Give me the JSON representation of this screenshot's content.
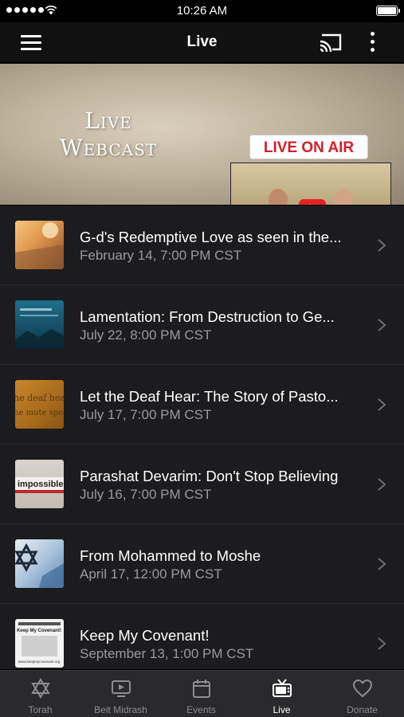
{
  "status_bar": {
    "time": "10:26 AM"
  },
  "nav": {
    "title": "Live"
  },
  "banner": {
    "title_line1": "Live",
    "title_line2": "Webcast",
    "badge": "LIVE ON AIR"
  },
  "events": [
    {
      "title": "G-d's Redemptive Love as seen in the...",
      "date": "February 14, 7:00 PM CST"
    },
    {
      "title": "Lamentation: From Destruction to Ge...",
      "date": "July 22, 8:00 PM CST"
    },
    {
      "title": "Let the Deaf Hear: The Story of Pasto...",
      "date": "July 17, 7:00 PM CST"
    },
    {
      "title": "Parashat Devarim: Don't Stop Believing",
      "date": "July 16, 7:00 PM CST"
    },
    {
      "title": "From Mohammed to Moshe",
      "date": "April 17, 12:00 PM CST"
    },
    {
      "title": "Keep My Covenant!",
      "date": "September 13, 1:00 PM CST"
    }
  ],
  "thumbnail_text": {
    "deaf_line1": "he deaf hea",
    "deaf_line2": "he mute spea",
    "impossible": "impossible",
    "covenant_line1": "Keep My Covenant!",
    "covenant_site": "www.keepmycovenant.org"
  },
  "tabs": [
    {
      "label": "Torah",
      "icon": "star-of-david-icon",
      "active": false
    },
    {
      "label": "Beit Midrash",
      "icon": "video-screen-icon",
      "active": false
    },
    {
      "label": "Events",
      "icon": "calendar-icon",
      "active": false
    },
    {
      "label": "Live",
      "icon": "tv-icon",
      "active": true
    },
    {
      "label": "Donate",
      "icon": "heart-icon",
      "active": false
    }
  ],
  "colors": {
    "nav_background": "#111111",
    "list_background": "#1c1c1e",
    "tab_bar_background": "#2a2a2c",
    "badge_text": "#d0202a",
    "secondary_text": "#9a9a9e"
  }
}
